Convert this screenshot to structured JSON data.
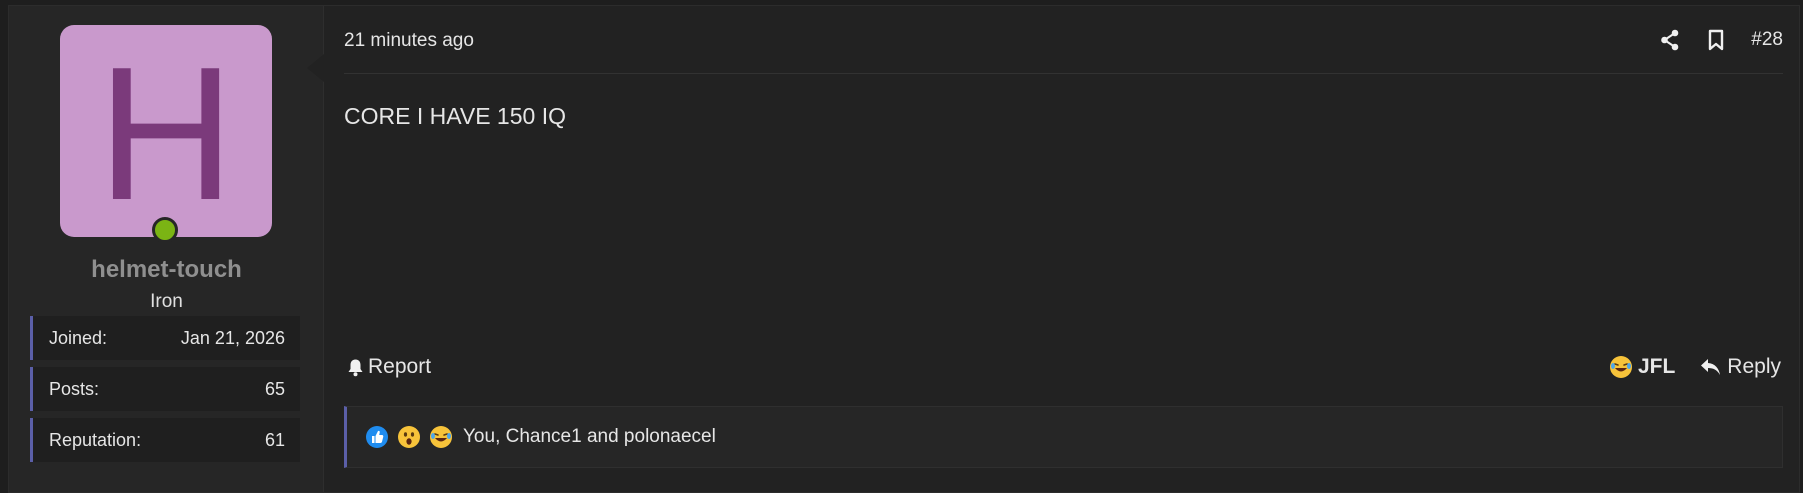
{
  "user": {
    "avatar_letter": "H",
    "avatar_color": "#c999cc",
    "avatar_letter_color": "#7b3a7b",
    "online_status_color": "#7bb414",
    "username": "helmet-touch",
    "title": "Iron",
    "stats": {
      "joined_label": "Joined:",
      "joined_value": "Jan 21, 2026",
      "posts_label": "Posts:",
      "posts_value": "65",
      "reputation_label": "Reputation:",
      "reputation_value": "61"
    }
  },
  "post": {
    "time": "21 minutes ago",
    "number": "#28",
    "body": "CORE I HAVE 150 IQ",
    "icons": {
      "share": "share-icon",
      "bookmark": "bookmark-icon"
    }
  },
  "actions": {
    "report_label": "Report",
    "reaction_label": "JFL",
    "reply_label": "Reply",
    "icons": {
      "report": "bell-icon",
      "reaction": "crying-laughing-emoji",
      "reply": "reply-arrow-icon"
    }
  },
  "reactions": {
    "icons": [
      "thumbs-up-emoji",
      "astonished-emoji",
      "crying-laughing-emoji"
    ],
    "summary": "You, Chance1 and polonaecel"
  },
  "colors": {
    "accent": "#5b5fa8",
    "background": "#1e1e1e",
    "panel": "#222222",
    "sidebar": "#262626"
  }
}
